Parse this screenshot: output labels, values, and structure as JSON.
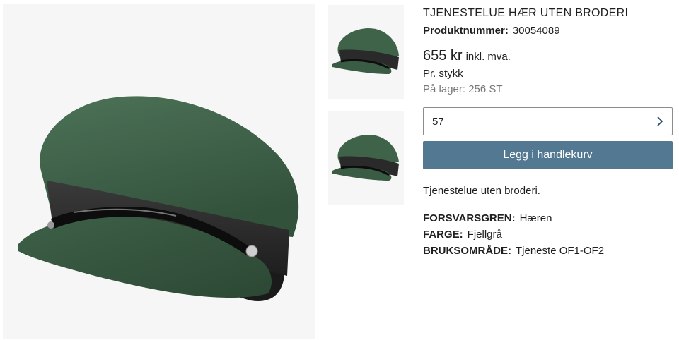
{
  "product": {
    "title": "TJENESTELUE HÆR UTEN BRODERI",
    "number_label": "Produktnummer:",
    "number_value": "30054089",
    "price": "655 kr",
    "vat": "inkl. mva.",
    "unit": "Pr. stykk",
    "stock": "På lager: 256 ST",
    "description": "Tjenestelue uten broderi."
  },
  "size_select": {
    "value": "57",
    "icon": "chevron-right-icon"
  },
  "cart_button": {
    "label": "Legg i handlekurv",
    "color": "#527892"
  },
  "attributes": [
    {
      "key": "FORSVARSGREN:",
      "value": "Hæren"
    },
    {
      "key": "FARGE:",
      "value": "Fjellgrå"
    },
    {
      "key": "BRUKSOMRÅDE:",
      "value": "Tjeneste OF1-OF2"
    }
  ],
  "colors": {
    "cap_green": "#3f6349",
    "band": "#2a2a2a",
    "image_bg": "#f6f6f6"
  }
}
